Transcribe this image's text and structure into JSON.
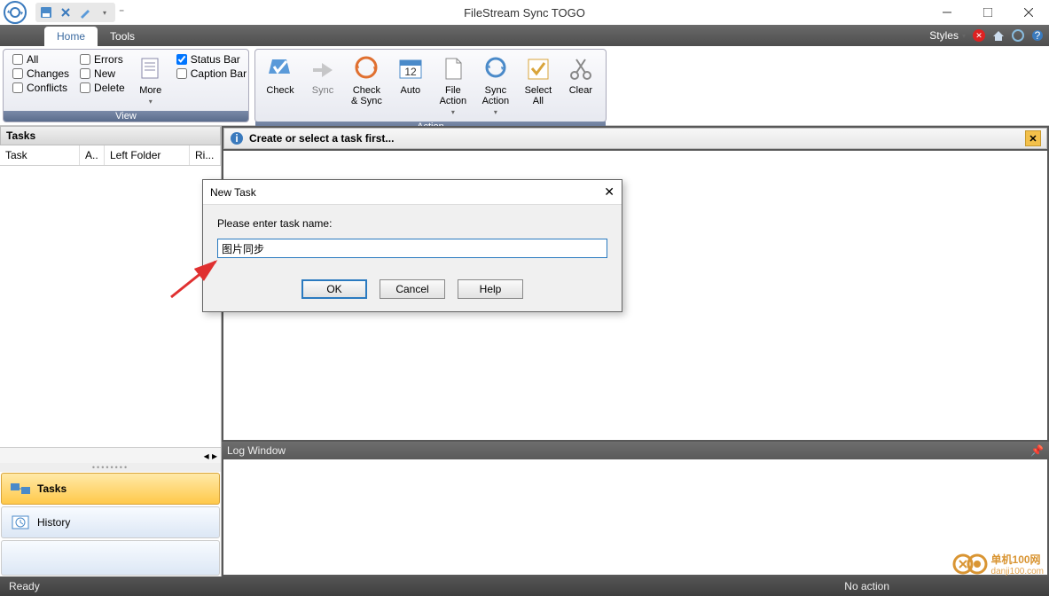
{
  "app_title": "FileStream Sync TOGO",
  "tabs": {
    "home": "Home",
    "tools": "Tools"
  },
  "right_menu": {
    "styles": "Styles"
  },
  "ribbon": {
    "view": {
      "label": "View",
      "all": "All",
      "errors": "Errors",
      "changes": "Changes",
      "new": "New",
      "conflicts": "Conflicts",
      "delete": "Delete",
      "more": "More",
      "status_bar": "Status Bar",
      "caption_bar": "Caption Bar"
    },
    "action": {
      "label": "Action",
      "check": "Check",
      "sync": "Sync",
      "check_sync": "Check\n& Sync",
      "auto": "Auto",
      "file_action": "File\nAction",
      "sync_action": "Sync\nAction",
      "select_all": "Select\nAll",
      "clear": "Clear"
    }
  },
  "info_bar": "Create or select a task first...",
  "tasks_panel": {
    "header": "Tasks",
    "cols": {
      "task": "Task",
      "a": "A..",
      "left": "Left Folder",
      "right": "Ri..."
    }
  },
  "nav": {
    "tasks": "Tasks",
    "history": "History"
  },
  "log_window": "Log Window",
  "status": {
    "ready": "Ready",
    "no_action": "No action"
  },
  "dialog": {
    "title": "New Task",
    "prompt": "Please enter task name:",
    "value": "图片同步",
    "ok": "OK",
    "cancel": "Cancel",
    "help": "Help"
  },
  "watermark": {
    "line1": "单机100网",
    "line2": "danji100.com"
  }
}
